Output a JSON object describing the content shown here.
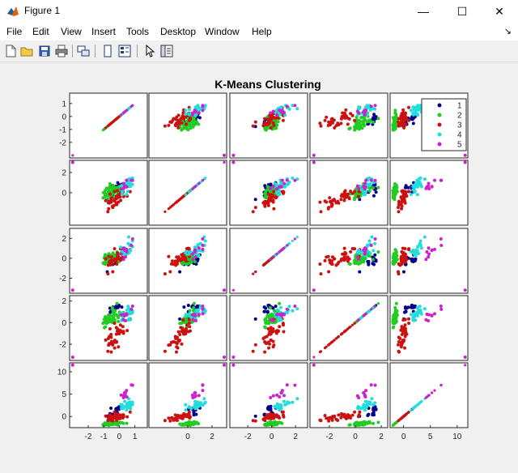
{
  "window": {
    "title": "Figure 1",
    "minimize_glyph": "—",
    "maximize_glyph": "☐",
    "close_glyph": "✕"
  },
  "menu": [
    "File",
    "Edit",
    "View",
    "Insert",
    "Tools",
    "Desktop",
    "Window",
    "Help"
  ],
  "dock_glyph": "↘",
  "toolbar": [
    {
      "name": "new-figure-icon"
    },
    {
      "name": "open-file-icon"
    },
    {
      "name": "save-figure-icon"
    },
    {
      "name": "print-figure-icon"
    },
    {
      "sep": true
    },
    {
      "name": "link-plot-icon"
    },
    {
      "sep": true
    },
    {
      "name": "hide-plot-tools-icon"
    },
    {
      "name": "show-plot-tools-icon"
    },
    {
      "sep": true
    },
    {
      "name": "edit-plot-arrow-icon"
    },
    {
      "name": "open-property-inspector-icon"
    }
  ],
  "chart_data": {
    "type": "scatter",
    "title": "K-Means Clustering",
    "grid_size": [
      5,
      5
    ],
    "diagonal": "identity-line",
    "variables": [
      {
        "index": 1,
        "range": [
          -3.2,
          1.8
        ],
        "ticks": [
          -2,
          -1,
          0,
          1
        ]
      },
      {
        "index": 2,
        "range": [
          -3.2,
          3.2
        ],
        "ticks": [
          0,
          2
        ]
      },
      {
        "index": 3,
        "range": [
          -3.5,
          3.0
        ],
        "ticks": [
          -2,
          0,
          2
        ]
      },
      {
        "index": 4,
        "range": [
          -3.5,
          2.5
        ],
        "ticks": [
          -2,
          0,
          2
        ]
      },
      {
        "index": 5,
        "range": [
          -2.5,
          12.0
        ],
        "ticks": [
          0,
          5,
          10
        ]
      }
    ],
    "x_tick_labels_bottom": [
      [
        "-2",
        "-1",
        "0",
        "1"
      ],
      [
        "0",
        "2"
      ],
      [
        "-2",
        "0",
        "2"
      ],
      [
        "-2",
        "0",
        "2"
      ],
      [
        "0",
        "5",
        "10"
      ]
    ],
    "y_tick_labels_left": [
      [
        "1",
        "0",
        "-1",
        "-2"
      ],
      [
        "2",
        "0"
      ],
      [
        "2",
        "0",
        "-2"
      ],
      [
        "2",
        "0",
        "-2"
      ],
      [
        "10",
        "5",
        "0"
      ]
    ],
    "legend": {
      "placement": "top-right of first row"
    },
    "series": [
      {
        "name": "1",
        "color": "#00008b",
        "center": [
          -0.2,
          0.5,
          -0.3,
          1.3,
          1.2
        ],
        "spread": [
          0.35,
          0.6,
          0.5,
          0.4,
          0.8
        ],
        "count": 18
      },
      {
        "name": "2",
        "color": "#22cc22",
        "center": [
          -0.5,
          0.1,
          0.0,
          0.4,
          -1.6
        ],
        "spread": [
          0.5,
          0.55,
          0.55,
          0.6,
          0.3
        ],
        "count": 60
      },
      {
        "name": "3",
        "color": "#cc1111",
        "center": [
          -0.3,
          -0.7,
          -0.2,
          -1.4,
          -0.1
        ],
        "spread": [
          0.55,
          0.7,
          0.7,
          1.0,
          0.7
        ],
        "count": 40
      },
      {
        "name": "4",
        "color": "#22dddd",
        "center": [
          0.4,
          0.7,
          0.8,
          0.7,
          2.3
        ],
        "spread": [
          0.4,
          0.6,
          0.6,
          0.6,
          0.8
        ],
        "count": 26
      },
      {
        "name": "5",
        "color": "#cc22cc",
        "center": [
          0.3,
          0.4,
          0.5,
          0.6,
          4.5
        ],
        "spread": [
          0.4,
          0.6,
          0.5,
          0.5,
          1.2
        ],
        "count": 10
      }
    ],
    "outlier": {
      "series": "5",
      "values": [
        -3.0,
        3.0,
        -3.2,
        -3.2,
        11.5
      ]
    }
  }
}
